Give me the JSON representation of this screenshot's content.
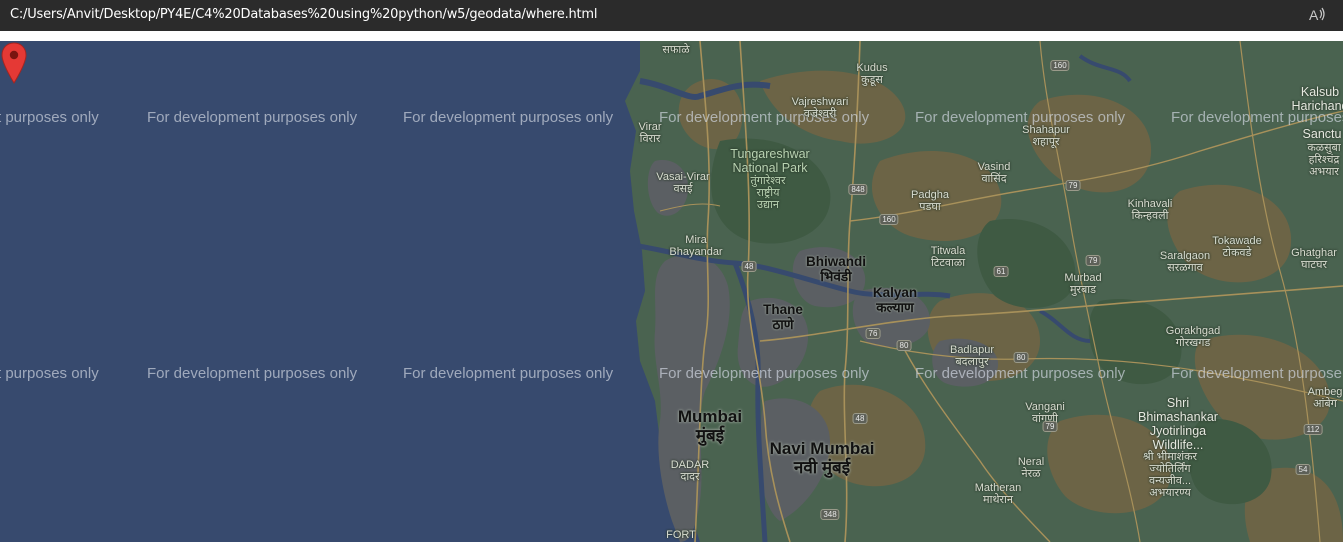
{
  "browser": {
    "url": "C:/Users/Anvit/Desktop/PY4E/C4%20Databases%20using%20python/w5/geodata/where.html",
    "read_aloud_icon": "read-aloud-icon"
  },
  "map": {
    "watermark_text": "For development purposes only",
    "watermark_row1": [
      "t purposes only",
      "For development purposes only",
      "For development purposes only",
      "For development purposes only",
      "For development purposes only",
      "For development purposes"
    ],
    "watermark_row2": [
      "t purposes only",
      "For development purposes only",
      "For development purposes only",
      "For development purposes only",
      "For development purposes only",
      "For development purpose"
    ],
    "places": {
      "saphale": "सफाळे",
      "kudus": "Kudus",
      "kudus_hi": "कुडूस",
      "vajreshwari": "Vajreshwari",
      "vajreshwari_hi": "वज्रेश्वरी",
      "virar": "Virar",
      "virar_hi": "विरार",
      "tungareshwar": "Tungareshwar",
      "national_park": "National Park",
      "tungareshwar_hi1": "तुंगारेश्वर",
      "tungareshwar_hi2": "राष्ट्रीय",
      "tungareshwar_hi3": "उद्यान",
      "vasai_virar": "Vasai-Virar",
      "vasai_virar_hi": "वसई",
      "shahapur": "Shahapur",
      "shahapur_hi": "शहापूर",
      "vasind": "Vasind",
      "vasind_hi": "वासिंद",
      "padgha": "Padgha",
      "padgha_hi": "पडघा",
      "kinhavali": "Kinhavali",
      "kinhavali_hi": "किन्हवली",
      "mira_bhayandar": "Mira",
      "mira_bhayandar2": "Bhayandar",
      "bhiwandi": "Bhiwandi",
      "bhiwandi_hi": "भिवंडी",
      "titwala": "Titwala",
      "titwala_hi": "टिटवाळा",
      "saralgaon": "Saralgaon",
      "saralgaon_hi": "सरळगाव",
      "tokawade": "Tokawade",
      "tokawade_hi": "टोकवडे",
      "ghatghar": "Ghatghar",
      "ghatghar_hi": "घाटघर",
      "kalsubai": "Kalsub",
      "harichand": "Harichand",
      "kalsubai_hi": "कळसुबा",
      "harichand_hi": "हरिश्चंद्र",
      "harichand_hi2": "अभयार",
      "sanctu": "Sanctu",
      "kalyan": "Kalyan",
      "kalyan_hi": "कल्याण",
      "thane": "Thane",
      "thane_hi": "ठाणे",
      "murbad": "Murbad",
      "murbad_hi": "मुरबाड",
      "gorakhgad": "Gorakhgad",
      "gorakhgad_hi": "गोरखगड",
      "badlapur": "Badlapur",
      "badlapur_hi": "बदलापुर",
      "mumbai": "Mumbai",
      "mumbai_hi": "मुंबई",
      "vangani": "Vangani",
      "vangani_hi": "वांगणी",
      "navi_mumbai": "Navi Mumbai",
      "navi_mumbai_hi": "नवी मुंबई",
      "shri": "Shri",
      "bhimashankar": "Bhimashankar",
      "jyotirlinga": "Jyotirlinga",
      "wildlife": "Wildlife...",
      "bhimashankar_hi1": "श्री भीमाशंकर",
      "bhimashankar_hi2": "ज्योतिर्लिंग",
      "bhimashankar_hi3": "वन्यजीव...",
      "bhimashankar_hi4": "अभयारण्य",
      "dadar": "DADAR",
      "dadar_hi": "दादर",
      "neral": "Neral",
      "neral_hi": "नेरळ",
      "matheran": "Matheran",
      "matheran_hi": "माथेरान",
      "ambeg": "Ambeg",
      "ambeg_hi": "आंबेग",
      "fort": "FORT"
    },
    "shields": {
      "r160a": "160",
      "r160b": "160",
      "r848": "848",
      "r48a": "48",
      "r48b": "48",
      "r79a": "79",
      "r79b": "79",
      "r79c": "79",
      "r61": "61",
      "r76": "76",
      "r80a": "80",
      "r80b": "80",
      "r112": "112",
      "r54": "54",
      "r348": "348"
    },
    "marker": "map-marker-icon",
    "colors": {
      "sea": "#374a6e",
      "land": "#4a6350",
      "forest": "#3f5a43",
      "dry_land": "#6c6446",
      "urban": "#5b5f63",
      "marker": "#e53935"
    }
  }
}
